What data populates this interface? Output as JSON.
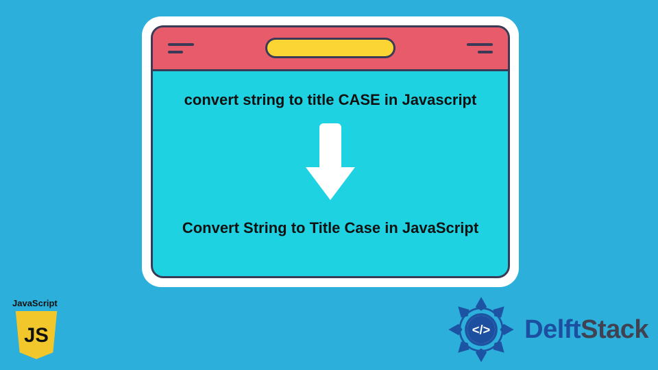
{
  "diagram": {
    "input_text": "convert string to title CASE in Javascript",
    "output_text": "Convert String to Title Case in JavaScript"
  },
  "window": {
    "titlebar_color": "#e85b6a",
    "pill_color": "#fad534",
    "body_color": "#1fd2e2",
    "border_color": "#3a3a57"
  },
  "logo_js": {
    "label": "JavaScript",
    "glyph": "JS",
    "bg": "#f2c72b",
    "fg": "#111111"
  },
  "brand": {
    "name_pre": "Delft",
    "name_post": "Stack",
    "code_glyph": "</>",
    "accent_color": "#1c4fa0",
    "text_color": "#404252"
  },
  "colors": {
    "page_bg": "#2dafdb",
    "arrow": "#ffffff",
    "text": "#111111"
  }
}
